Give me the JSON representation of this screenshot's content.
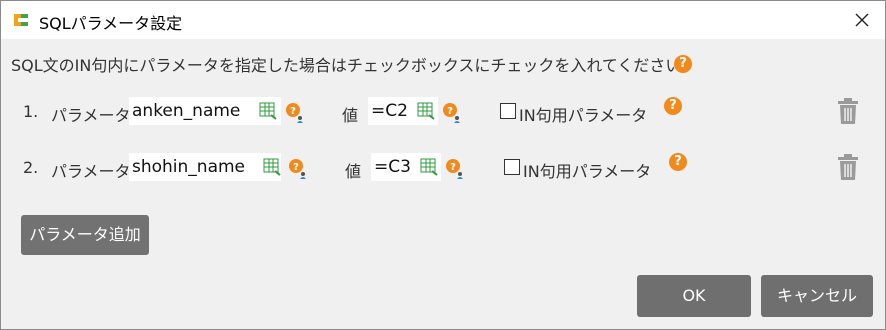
{
  "window": {
    "title": "SQLパラメータ設定",
    "close_icon": "close-icon"
  },
  "instruction": {
    "text": "SQL文のIN句内にパラメータを指定した場合はチェックボックスにチェックを入れてください。"
  },
  "rows": [
    {
      "number": "1.",
      "param_label": "パラメータ",
      "param_value": "anken_name",
      "value_label": "値",
      "value": "=C2",
      "in_label": "IN句用パラメータ",
      "in_checked": false
    },
    {
      "number": "2.",
      "param_label": "パラメータ",
      "param_value": "shohin_name",
      "value_label": "値",
      "value": "=C3",
      "in_label": "IN句用パラメータ",
      "in_checked": false
    }
  ],
  "buttons": {
    "add_param": "パラメータ追加",
    "ok": "OK",
    "cancel": "キャンセル"
  },
  "colors": {
    "help_accent": "#f08a1c",
    "button_bg": "#6f6f6f",
    "dialog_bg": "#f0f0f0",
    "grid_icon_green": "#2e9b3c"
  }
}
